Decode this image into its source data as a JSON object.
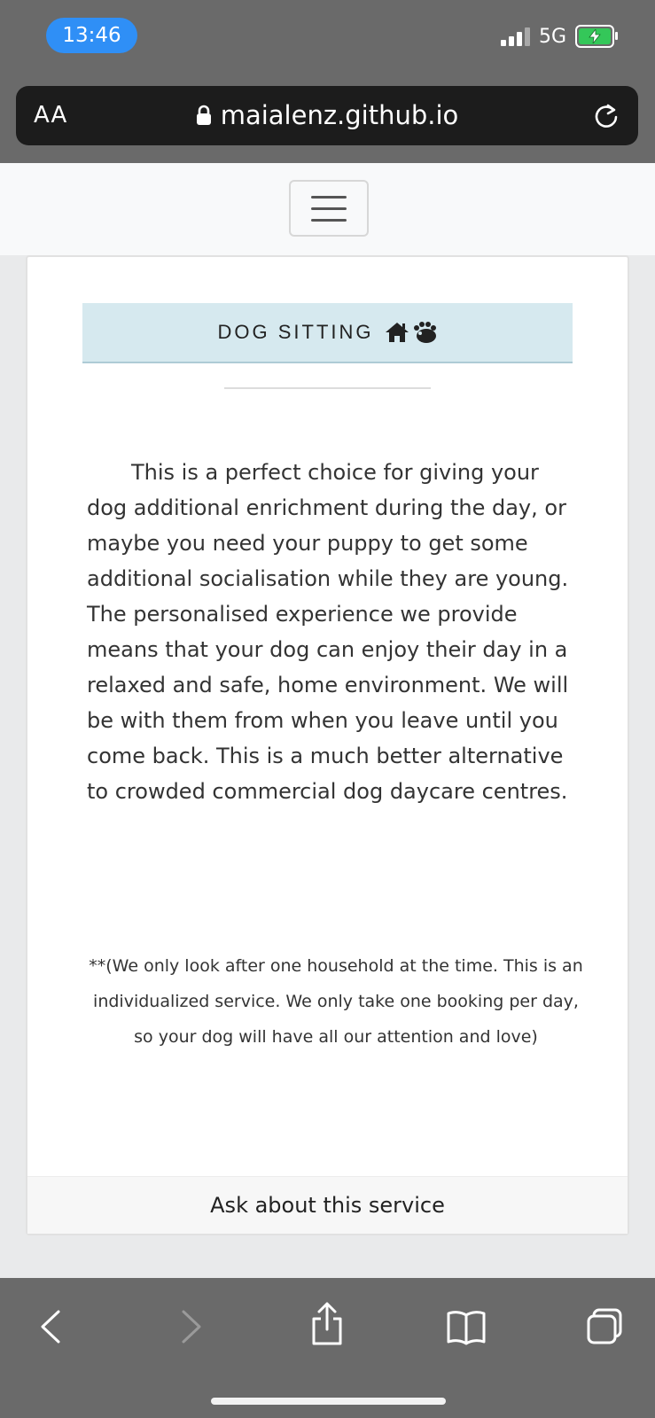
{
  "status_bar": {
    "time": "13:46",
    "network": "5G",
    "icons": [
      "signal-bars-icon",
      "battery-charging-icon"
    ],
    "accent_color": "#2f8ff6",
    "battery_color": "#34c759"
  },
  "browser": {
    "reader_button": "AA",
    "url": "maialenz.github.io",
    "icons": [
      "lock-icon",
      "reload-icon"
    ]
  },
  "nav": {
    "menu_icon": "hamburger-menu-icon"
  },
  "service_card": {
    "title": "DOG SITTING",
    "title_icons": [
      "house-icon",
      "dog-paw-icon"
    ],
    "description": "This is a perfect choice for giving your dog additional enrichment during the day, or maybe you need your puppy to get some additional socialisation while they are young. The personalised experience we provide means that your dog can enjoy their day in a relaxed and safe, home environment. We will be with them from when you leave until you come back. This is a much better alternative to crowded commercial dog daycare centres.",
    "note": "**(We only look after one household at the time. This is an individualized service. We only take one booking per day, so your dog will have all our attention and love)",
    "footer_link": "Ask about this service",
    "header_color": "#d6e9ef"
  },
  "toolbar": {
    "icons": [
      "back-icon",
      "forward-icon",
      "share-icon",
      "bookmarks-icon",
      "tabs-icon"
    ]
  }
}
